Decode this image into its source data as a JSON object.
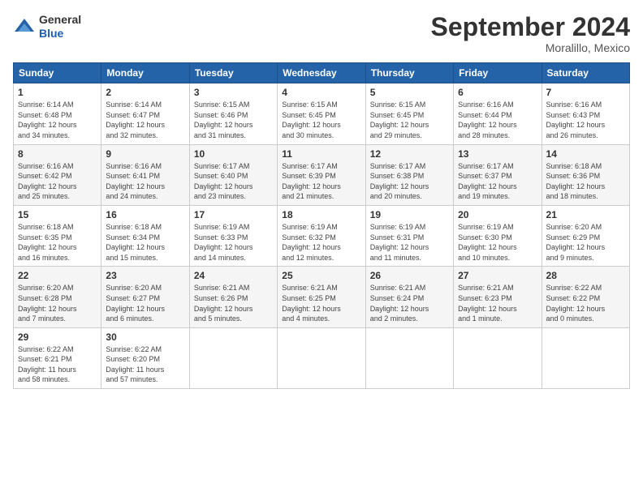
{
  "logo": {
    "general": "General",
    "blue": "Blue"
  },
  "header": {
    "month": "September 2024",
    "location": "Moralillo, Mexico"
  },
  "days_of_week": [
    "Sunday",
    "Monday",
    "Tuesday",
    "Wednesday",
    "Thursday",
    "Friday",
    "Saturday"
  ],
  "weeks": [
    [
      {
        "day": "1",
        "sunrise": "6:14 AM",
        "sunset": "6:48 PM",
        "daylight": "12 hours and 34 minutes."
      },
      {
        "day": "2",
        "sunrise": "6:14 AM",
        "sunset": "6:47 PM",
        "daylight": "12 hours and 32 minutes."
      },
      {
        "day": "3",
        "sunrise": "6:15 AM",
        "sunset": "6:46 PM",
        "daylight": "12 hours and 31 minutes."
      },
      {
        "day": "4",
        "sunrise": "6:15 AM",
        "sunset": "6:45 PM",
        "daylight": "12 hours and 30 minutes."
      },
      {
        "day": "5",
        "sunrise": "6:15 AM",
        "sunset": "6:45 PM",
        "daylight": "12 hours and 29 minutes."
      },
      {
        "day": "6",
        "sunrise": "6:16 AM",
        "sunset": "6:44 PM",
        "daylight": "12 hours and 28 minutes."
      },
      {
        "day": "7",
        "sunrise": "6:16 AM",
        "sunset": "6:43 PM",
        "daylight": "12 hours and 26 minutes."
      }
    ],
    [
      {
        "day": "8",
        "sunrise": "6:16 AM",
        "sunset": "6:42 PM",
        "daylight": "12 hours and 25 minutes."
      },
      {
        "day": "9",
        "sunrise": "6:16 AM",
        "sunset": "6:41 PM",
        "daylight": "12 hours and 24 minutes."
      },
      {
        "day": "10",
        "sunrise": "6:17 AM",
        "sunset": "6:40 PM",
        "daylight": "12 hours and 23 minutes."
      },
      {
        "day": "11",
        "sunrise": "6:17 AM",
        "sunset": "6:39 PM",
        "daylight": "12 hours and 21 minutes."
      },
      {
        "day": "12",
        "sunrise": "6:17 AM",
        "sunset": "6:38 PM",
        "daylight": "12 hours and 20 minutes."
      },
      {
        "day": "13",
        "sunrise": "6:17 AM",
        "sunset": "6:37 PM",
        "daylight": "12 hours and 19 minutes."
      },
      {
        "day": "14",
        "sunrise": "6:18 AM",
        "sunset": "6:36 PM",
        "daylight": "12 hours and 18 minutes."
      }
    ],
    [
      {
        "day": "15",
        "sunrise": "6:18 AM",
        "sunset": "6:35 PM",
        "daylight": "12 hours and 16 minutes."
      },
      {
        "day": "16",
        "sunrise": "6:18 AM",
        "sunset": "6:34 PM",
        "daylight": "12 hours and 15 minutes."
      },
      {
        "day": "17",
        "sunrise": "6:19 AM",
        "sunset": "6:33 PM",
        "daylight": "12 hours and 14 minutes."
      },
      {
        "day": "18",
        "sunrise": "6:19 AM",
        "sunset": "6:32 PM",
        "daylight": "12 hours and 12 minutes."
      },
      {
        "day": "19",
        "sunrise": "6:19 AM",
        "sunset": "6:31 PM",
        "daylight": "12 hours and 11 minutes."
      },
      {
        "day": "20",
        "sunrise": "6:19 AM",
        "sunset": "6:30 PM",
        "daylight": "12 hours and 10 minutes."
      },
      {
        "day": "21",
        "sunrise": "6:20 AM",
        "sunset": "6:29 PM",
        "daylight": "12 hours and 9 minutes."
      }
    ],
    [
      {
        "day": "22",
        "sunrise": "6:20 AM",
        "sunset": "6:28 PM",
        "daylight": "12 hours and 7 minutes."
      },
      {
        "day": "23",
        "sunrise": "6:20 AM",
        "sunset": "6:27 PM",
        "daylight": "12 hours and 6 minutes."
      },
      {
        "day": "24",
        "sunrise": "6:21 AM",
        "sunset": "6:26 PM",
        "daylight": "12 hours and 5 minutes."
      },
      {
        "day": "25",
        "sunrise": "6:21 AM",
        "sunset": "6:25 PM",
        "daylight": "12 hours and 4 minutes."
      },
      {
        "day": "26",
        "sunrise": "6:21 AM",
        "sunset": "6:24 PM",
        "daylight": "12 hours and 2 minutes."
      },
      {
        "day": "27",
        "sunrise": "6:21 AM",
        "sunset": "6:23 PM",
        "daylight": "12 hours and 1 minute."
      },
      {
        "day": "28",
        "sunrise": "6:22 AM",
        "sunset": "6:22 PM",
        "daylight": "12 hours and 0 minutes."
      }
    ],
    [
      {
        "day": "29",
        "sunrise": "6:22 AM",
        "sunset": "6:21 PM",
        "daylight": "11 hours and 58 minutes."
      },
      {
        "day": "30",
        "sunrise": "6:22 AM",
        "sunset": "6:20 PM",
        "daylight": "11 hours and 57 minutes."
      },
      null,
      null,
      null,
      null,
      null
    ]
  ]
}
